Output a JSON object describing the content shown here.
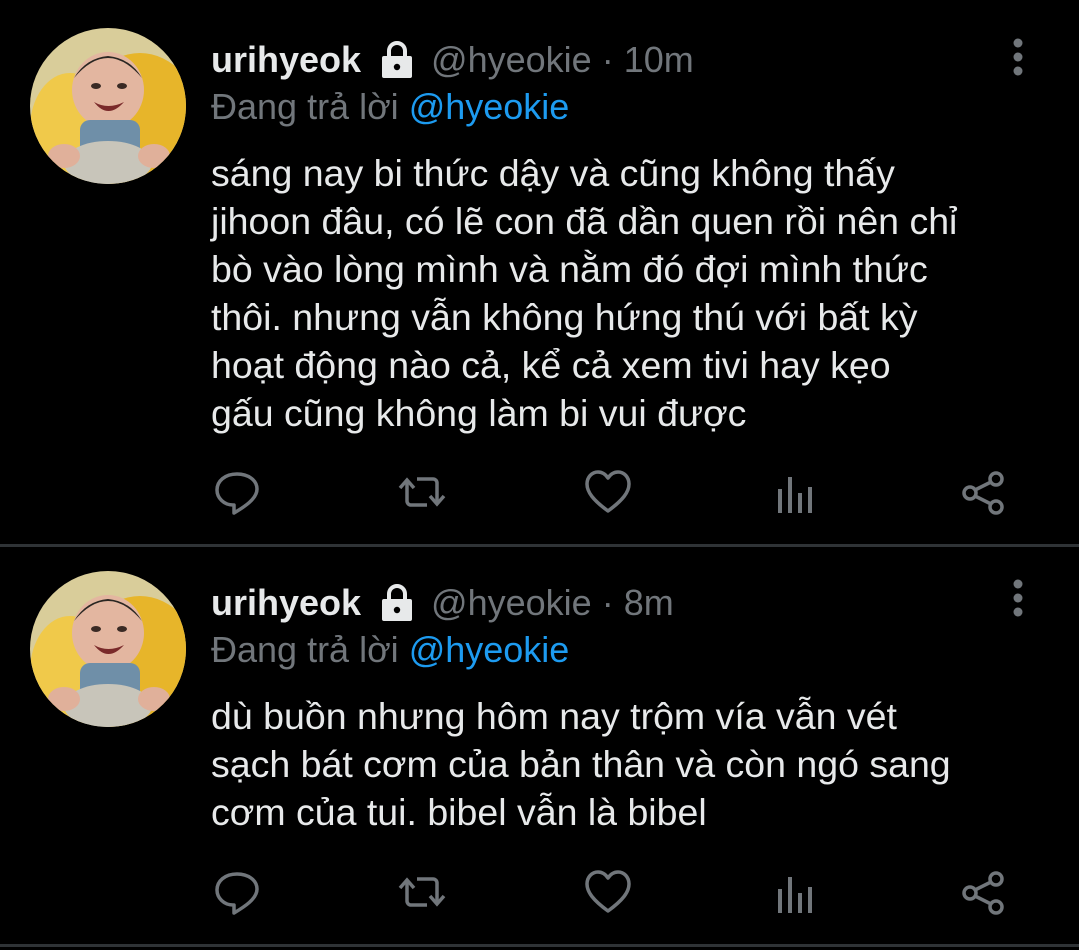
{
  "tweets": [
    {
      "name": "urihyeok",
      "handle": "@hyeokie",
      "separator": "·",
      "time": "10m",
      "reply_prefix": "Đang trả lời ",
      "reply_to": "@hyeokie",
      "lines": [
        "sáng nay bi thức dậy và cũng không thấy",
        "jihoon đâu, có lẽ con đã dần quen rồi nên chỉ",
        "bò vào lòng mình và nằm đó đợi mình thức",
        "thôi. nhưng vẫn không hứng thú với bất kỳ",
        "hoạt động nào cả, kể cả xem tivi hay kẹo",
        "gấu cũng không làm bi vui được"
      ]
    },
    {
      "name": "urihyeok",
      "handle": "@hyeokie",
      "separator": "·",
      "time": "8m",
      "reply_prefix": "Đang trả lời ",
      "reply_to": "@hyeokie",
      "lines": [
        "dù buồn nhưng hôm nay trộm vía vẫn vét",
        "sạch bát cơm của bản thân và còn ngó sang",
        "cơm của tui. bibel vẫn là bibel"
      ]
    }
  ],
  "icons": {
    "lock": "lock-icon",
    "more": "more-vertical-icon",
    "reply": "reply-icon",
    "retweet": "retweet-icon",
    "like": "like-icon",
    "analytics": "analytics-icon",
    "share": "share-icon"
  },
  "colors": {
    "background": "#000000",
    "text": "#e7e9ea",
    "secondary": "#71767b",
    "accent": "#1d9bf0",
    "divider": "#2f3336"
  }
}
